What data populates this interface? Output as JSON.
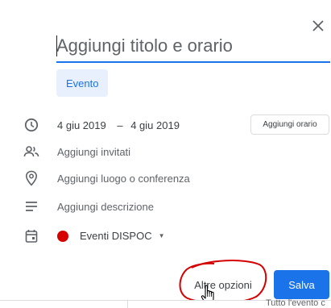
{
  "dialog": {
    "title_placeholder": "Aggiungi titolo e orario",
    "tab_event": "Evento",
    "date_start": "4 giu 2019",
    "date_separator": "–",
    "date_end": "4 giu 2019",
    "add_time_label": "Aggiungi orario",
    "add_guests": "Aggiungi invitati",
    "add_location": "Aggiungi luogo o conferenza",
    "add_description": "Aggiungi descrizione",
    "calendar_name": "Eventi DISPOC",
    "calendar_color": "#d50000",
    "more_options": "Altre opzioni",
    "save": "Salva"
  },
  "background": {
    "partial_text": "Tutto l'evento c"
  },
  "colors": {
    "accent": "#1a73e8",
    "chip_bg": "#e8f0fe",
    "highlight_ring": "#d50000"
  },
  "icons": [
    "close-icon",
    "clock-icon",
    "people-icon",
    "location-pin-icon",
    "notes-icon",
    "calendar-icon",
    "dropdown-arrow-icon",
    "hand-cursor-icon"
  ]
}
